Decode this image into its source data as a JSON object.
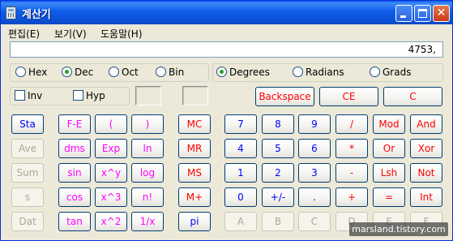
{
  "window": {
    "title": "계산기"
  },
  "menu": [
    "편집(E)",
    "보기(V)",
    "도움말(H)"
  ],
  "display": {
    "value": "4753,"
  },
  "base_options": [
    {
      "label": "Hex",
      "selected": false
    },
    {
      "label": "Dec",
      "selected": true
    },
    {
      "label": "Oct",
      "selected": false
    },
    {
      "label": "Bin",
      "selected": false
    }
  ],
  "angle_options": [
    {
      "label": "Degrees",
      "selected": true
    },
    {
      "label": "Radians",
      "selected": false
    },
    {
      "label": "Grads",
      "selected": false
    }
  ],
  "checkboxes": [
    {
      "label": "Inv",
      "checked": false
    },
    {
      "label": "Hyp",
      "checked": false
    }
  ],
  "buttons": {
    "backspace": "Backspace",
    "ce": "CE",
    "c": "C",
    "sta": "Sta",
    "ave": "Ave",
    "sum": "Sum",
    "s": "s",
    "dat": "Dat",
    "fe": "F-E",
    "lparen": "(",
    "rparen": ")",
    "dms": "dms",
    "exp": "Exp",
    "ln": "ln",
    "sin": "sin",
    "xpowy": "x^y",
    "log": "log",
    "cos": "cos",
    "xcube": "x^3",
    "fact": "n!",
    "tan": "tan",
    "xsq": "x^2",
    "recip": "1/x",
    "mc": "MC",
    "mr": "MR",
    "ms": "MS",
    "mplus": "M+",
    "pi": "pi",
    "d7": "7",
    "d8": "8",
    "d9": "9",
    "div": "/",
    "mod": "Mod",
    "and": "And",
    "d4": "4",
    "d5": "5",
    "d6": "6",
    "mul": "*",
    "or": "Or",
    "xor": "Xor",
    "d1": "1",
    "d2": "2",
    "d3": "3",
    "sub": "-",
    "lsh": "Lsh",
    "not": "Not",
    "d0": "0",
    "sign": "+/-",
    "dot": ".",
    "add": "+",
    "eq": "=",
    "int": "Int",
    "ha": "A",
    "hb": "B",
    "hc": "C",
    "hd": "D",
    "he": "E",
    "hf": "F"
  },
  "watermark": "marsland.tistory.com"
}
